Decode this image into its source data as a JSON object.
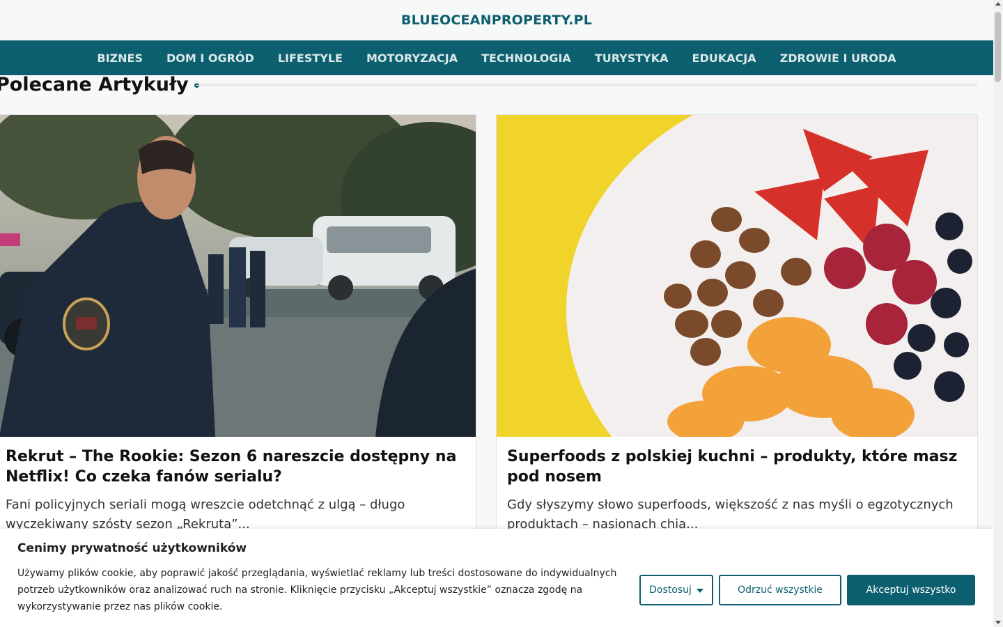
{
  "site": {
    "title": "BLUEOCEANPROPERTY.PL",
    "brand_color": "#0c5f6e"
  },
  "nav": {
    "items": [
      {
        "label": "BIZNES"
      },
      {
        "label": "DOM I OGRÓD"
      },
      {
        "label": "LIFESTYLE"
      },
      {
        "label": "MOTORYZACJA"
      },
      {
        "label": "TECHNOLOGIA"
      },
      {
        "label": "TURYSTYKA"
      },
      {
        "label": "EDUKACJA"
      },
      {
        "label": "ZDROWIE I URODA"
      }
    ]
  },
  "section": {
    "title": "Polecane Artykuły"
  },
  "articles": [
    {
      "image": "police-officer-photo",
      "title": "Rekrut – The Rookie: Sezon 6 nareszcie dostępny na Netflix! Co czeka fanów serialu?",
      "excerpt": "Fani policyjnych seriali mogą wreszcie odetchnąć z ulgą – długo wyczekiwany szósty sezon „Rekruta”..."
    },
    {
      "image": "fruit-bowl-photo",
      "title": "Superfoods z polskiej kuchni – produkty, które masz pod nosem",
      "excerpt": "Gdy słyszymy słowo superfoods, większość z nas myśli o egzotycznych produktach – nasionach chia..."
    }
  ],
  "cookie": {
    "title": "Cenimy prywatność użytkowników",
    "text": "Używamy plików cookie, aby poprawić jakość przeglądania, wyświetlać reklamy lub treści dostosowane do indywidualnych potrzeb użytkowników oraz analizować ruch na stronie. Kliknięcie przycisku „Akceptuj wszystkie” oznacza zgodę na wykorzystywanie przez nas plików cookie.",
    "customize_label": "Dostosuj",
    "reject_label": "Odrzuć wszystkie",
    "accept_label": "Akceptuj wszystko"
  }
}
